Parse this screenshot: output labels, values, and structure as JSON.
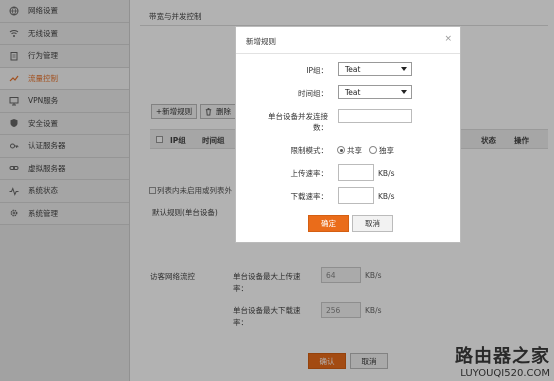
{
  "sidebar": {
    "items": [
      {
        "label": "网络设置",
        "icon": "globe-icon"
      },
      {
        "label": "无线设置",
        "icon": "wifi-icon"
      },
      {
        "label": "行为管理",
        "icon": "clipboard-icon"
      },
      {
        "label": "流量控制",
        "icon": "traffic-icon"
      },
      {
        "label": "VPN服务",
        "icon": "monitor-icon"
      },
      {
        "label": "安全设置",
        "icon": "shield-icon"
      },
      {
        "label": "认证服务器",
        "icon": "key-icon"
      },
      {
        "label": "虚拟服务器",
        "icon": "link-icon"
      },
      {
        "label": "系统状态",
        "icon": "pulse-icon"
      },
      {
        "label": "系统管理",
        "icon": "gear-icon"
      }
    ],
    "active_index": 3,
    "active_color": "#e8722a"
  },
  "main": {
    "title": "带宽与并发控制",
    "add_button": "+新增规则",
    "delete_button": "删除",
    "table_headers": [
      "IP组",
      "时间组",
      "状态",
      "操作"
    ],
    "note": "列表内未启用或列表外",
    "default_rule": "默认规则(单台设备)",
    "guest_label": "访客网络流控",
    "upload_label": "单台设备最大上传速率：",
    "upload_value": "64",
    "download_label": "单台设备最大下载速率：",
    "download_value": "256",
    "unit": "KB/s",
    "confirm": "确认",
    "cancel": "取消"
  },
  "modal": {
    "title": "新增规则",
    "close": "×",
    "ip_group_label": "IP组：",
    "ip_group_value": "Teat",
    "time_group_label": "时间组：",
    "time_group_value": "Teat",
    "concurrent_label_1": "单台设备并发连接",
    "concurrent_label_2": "数：",
    "concurrent_value": "",
    "limit_mode_label": "限制模式：",
    "mode_shared": "共享",
    "mode_exclusive": "独享",
    "upload_label": "上传速率：",
    "download_label": "下载速率：",
    "unit": "KB/s",
    "confirm": "确定",
    "cancel": "取消"
  },
  "watermark": {
    "text": "路由器之家",
    "url": "LUYOUQI520.COM"
  },
  "colors": {
    "accent": "#ea6c1a",
    "sidebar_bg": "#e9e9e9"
  }
}
